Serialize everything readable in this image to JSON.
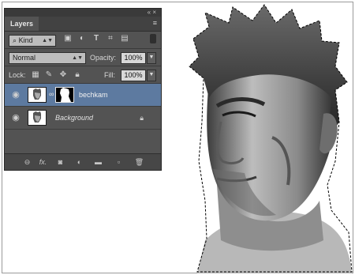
{
  "panel": {
    "collapse_glyph": "«",
    "close_glyph": "×",
    "tab_label": "Layers",
    "menu_glyph": "≡",
    "filter": {
      "search_glyph": "⌕",
      "value": "Kind"
    },
    "blend_mode": "Normal",
    "opacity_label": "Opacity:",
    "opacity_value": "100%",
    "lock_label": "Lock:",
    "fill_label": "Fill:",
    "fill_value": "100%",
    "layers": [
      {
        "name": "bechkam",
        "selected": true,
        "has_mask": true
      },
      {
        "name": "Background",
        "selected": false,
        "locked": true
      }
    ],
    "bottom_icons": [
      "link-icon",
      "fx-icon",
      "mask-icon",
      "adjustment-icon",
      "group-folder-icon",
      "new-layer-icon",
      "trash-icon"
    ],
    "fx_label": "fx."
  },
  "colors": {
    "panel_bg": "#535353",
    "selected_layer": "#5d7aa0"
  }
}
